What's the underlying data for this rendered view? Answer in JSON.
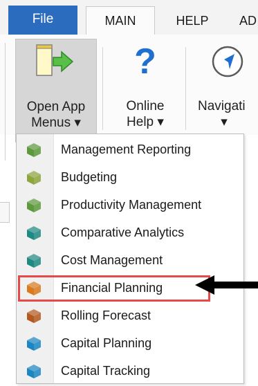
{
  "tabs": {
    "file": "File",
    "main": "MAIN",
    "help": "HELP",
    "ad": "AD"
  },
  "ribbon": {
    "open_app_menus": {
      "line1": "Open App",
      "line2": "Menus ▾",
      "icon": "open-app-menus-icon"
    },
    "online_help": {
      "line1": "Online",
      "line2": "Help ▾",
      "icon": "question-icon"
    },
    "navigation": {
      "line1": "Navigati",
      "line2": "▾",
      "icon": "compass-icon"
    }
  },
  "menu": {
    "items": [
      {
        "label": "Management Reporting",
        "color": "#5c9a3b"
      },
      {
        "label": "Budgeting",
        "color": "#8ea43c"
      },
      {
        "label": "Productivity Management",
        "color": "#5c9a3b"
      },
      {
        "label": "Comparative Analytics",
        "color": "#1f8a83"
      },
      {
        "label": "Cost Management",
        "color": "#1f8a83"
      },
      {
        "label": "Financial Planning",
        "color": "#d97a1e"
      },
      {
        "label": "Rolling Forecast",
        "color": "#b5581f"
      },
      {
        "label": "Capital Planning",
        "color": "#1b86c2"
      },
      {
        "label": "Capital Tracking",
        "color": "#1b86c2"
      }
    ],
    "highlighted_index": 5,
    "highlight_color": "#e44a4a"
  }
}
